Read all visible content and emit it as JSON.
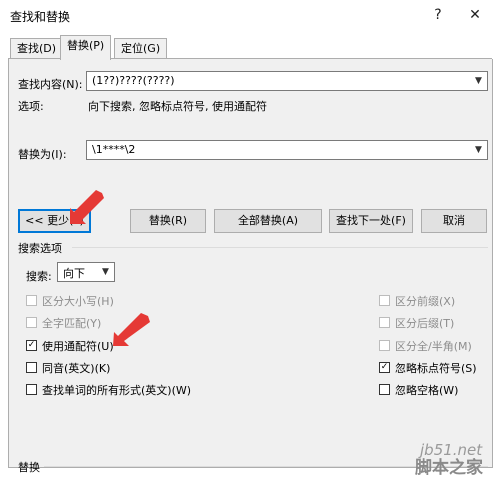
{
  "window": {
    "title": "查找和替换",
    "help_label": "?",
    "close_label": "✕"
  },
  "tabs": [
    {
      "label": "查找(D)"
    },
    {
      "label": "替换(P)"
    },
    {
      "label": "定位(G)"
    }
  ],
  "find": {
    "label": "查找内容(N):",
    "value": "(1??)????(????)",
    "options_label": "选项:",
    "options_value": "向下搜索, 忽略标点符号, 使用通配符"
  },
  "replace": {
    "label": "替换为(I):",
    "value": "\\1****\\2"
  },
  "buttons": {
    "less": "<< 更少(L)",
    "replace": "替换(R)",
    "replace_all": "全部替换(A)",
    "find_next": "查找下一处(F)",
    "cancel": "取消"
  },
  "search_options": {
    "section_label": "搜索选项",
    "search_label": "搜索:",
    "search_value": "向下"
  },
  "checkboxes_left": [
    {
      "label": "区分大小写(H)",
      "checked": false,
      "disabled": true
    },
    {
      "label": "全字匹配(Y)",
      "checked": false,
      "disabled": true
    },
    {
      "label": "使用通配符(U)",
      "checked": true,
      "disabled": false
    },
    {
      "label": "同音(英文)(K)",
      "checked": false,
      "disabled": false
    },
    {
      "label": "查找单词的所有形式(英文)(W)",
      "checked": false,
      "disabled": false
    }
  ],
  "checkboxes_right": [
    {
      "label": "区分前缀(X)",
      "checked": false,
      "disabled": true
    },
    {
      "label": "区分后缀(T)",
      "checked": false,
      "disabled": true
    },
    {
      "label": "区分全/半角(M)",
      "checked": false,
      "disabled": true
    },
    {
      "label": "忽略标点符号(S)",
      "checked": true,
      "disabled": false
    },
    {
      "label": "忽略空格(W)",
      "checked": false,
      "disabled": false
    }
  ],
  "bottom_section": {
    "label": "替换"
  },
  "watermark": {
    "line1": "jb51.net",
    "line2": "脚本之家"
  },
  "colors": {
    "annotation_arrow": "#e53935",
    "focus_border": "#0078d7"
  }
}
